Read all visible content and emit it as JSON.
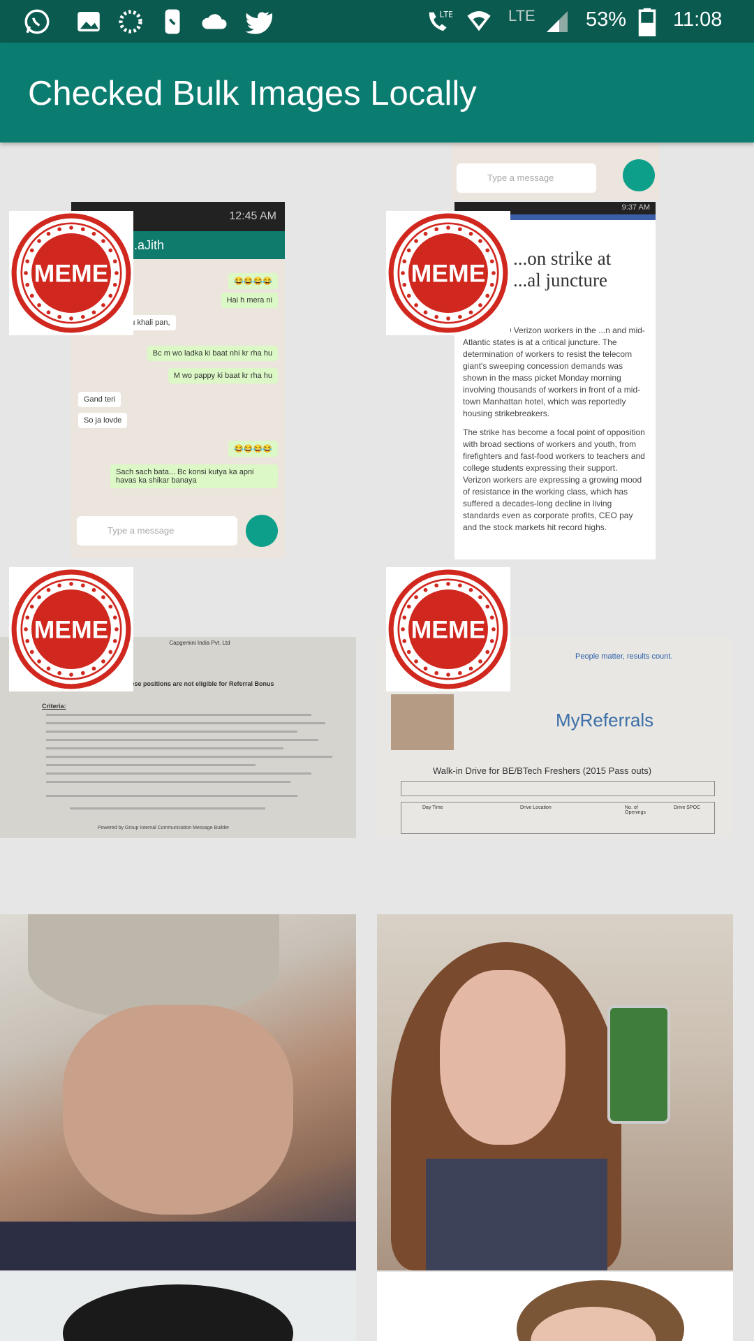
{
  "status_bar": {
    "icons": [
      "whatsapp-icon",
      "image-icon",
      "loading-icon",
      "phone-icon",
      "cloud-icon",
      "twitter-icon"
    ],
    "signal_label": "LTE",
    "battery_percent": "53%",
    "time": "11:08"
  },
  "app_bar": {
    "title": "Checked Bulk Images Locally"
  },
  "colors": {
    "status_bar": "#0a5a50",
    "app_bar": "#0b7d70",
    "background": "#e6e6e6",
    "meme_red": "#d0281f"
  },
  "badge": {
    "label": "MEME"
  },
  "tiles": {
    "chat_top_input": "Type a message",
    "chat": {
      "time": "12:45 AM",
      "contact": "...aJith",
      "messages": [
        "😂😂😂😂",
        "Hai h mera ni",
        "Saya hn sun fu khali pan,",
        "Bc m wo ladka ki baat nhi kr rha hu",
        "M wo pappy ki baat kr rha hu",
        "Gand teri",
        "So ja lovde",
        "😂😂😂😂",
        "Sach sach bata... Bc konsi kutya ka apni havas ka shikar banaya"
      ],
      "input_placeholder": "Type a message"
    },
    "article": {
      "time": "9:37 AM",
      "title_line1": "...on strike at",
      "title_line2": "...al juncture",
      "paragraph1": "...t by 39,000 Verizon workers in the ...n and mid-Atlantic states is at a critical juncture. The determination of workers to resist the telecom giant's sweeping concession demands was shown in the mass picket Monday morning involving thousands of workers in front of a mid-town Manhattan hotel, which was reportedly housing strikebreakers.",
      "paragraph2": "The strike has become a focal point of opposition with broad sections of workers and youth, from firefighters and fast-food workers to teachers and college students expressing their support. Verizon workers are expressing a growing mood of resistance in the working class, which has suffered a decades-long decline in living standards even as corporate profits, CEO pay and the stock markets hit record highs."
    },
    "doc_left": {
      "header": "Capgemini India Pvt. Ltd",
      "heading": "...ese positions are not eligible for Referral Bonus",
      "criteria_label": "Criteria:",
      "footer": "Powered by Group Internal Communication Message Builder"
    },
    "doc_right": {
      "tagline": "People matter, results count.",
      "brand": "MyReferrals",
      "headline": "Walk-in Drive for BE/BTech Freshers (2015 Pass outs)",
      "col_day_time": "Day Time",
      "col_drive_location": "Drive Location",
      "col_openings": "No. of Openings",
      "col_drive_spoc": "Drive SPOC"
    }
  }
}
